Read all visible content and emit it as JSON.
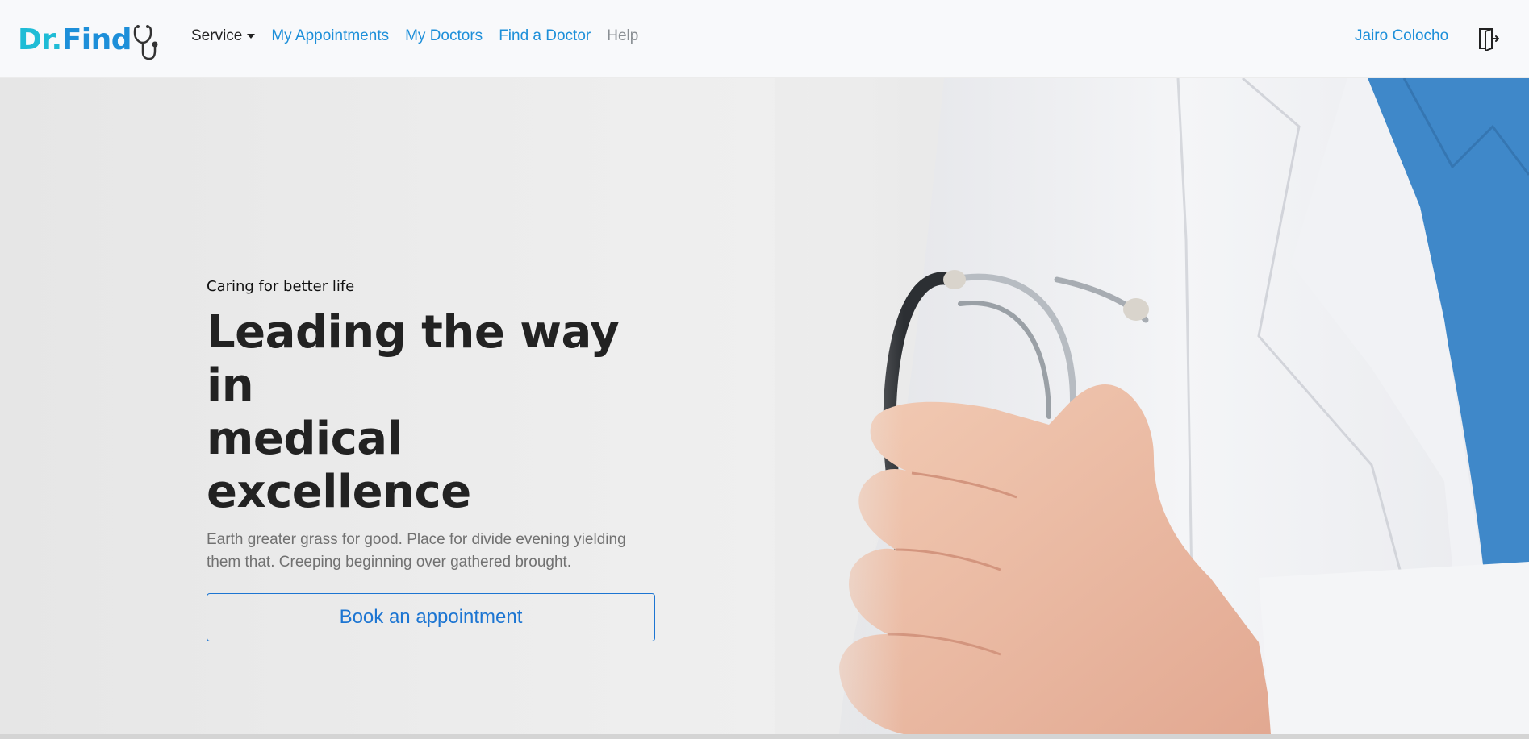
{
  "brand": {
    "part1": "Dr.",
    "part2": "Find",
    "color_primary": "#1fbcd6",
    "color_secondary": "#1d8fd9",
    "logo_icon": "stethoscope-icon"
  },
  "nav": {
    "service_label": "Service",
    "appointments_label": "My Appointments",
    "doctors_label": "My Doctors",
    "find_doctor_label": "Find a Doctor",
    "help_label": "Help",
    "user_name": "Jairo Colocho",
    "logout_icon": "logout-icon"
  },
  "hero": {
    "eyebrow": "Caring for better life",
    "headline_line1": "Leading the way in",
    "headline_line2": "medical excellence",
    "lead": "Earth greater grass for good. Place for divide evening yielding them that. Creeping beginning over gathered brought.",
    "cta_label": "Book an appointment",
    "accent_color": "#1c75d2",
    "image": "doctor-with-stethoscope"
  }
}
